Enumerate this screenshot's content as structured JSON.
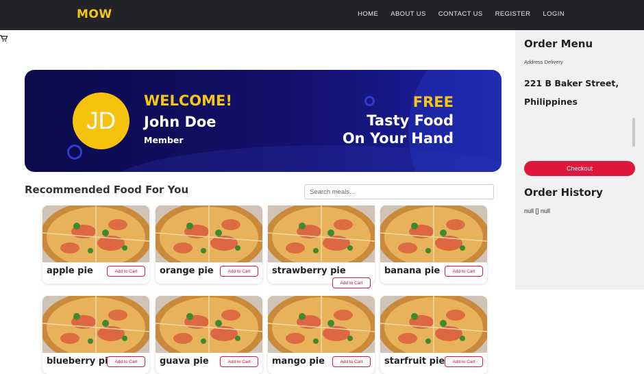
{
  "header": {
    "logo": "MOW",
    "nav": [
      "HOME",
      "ABOUT US",
      "CONTACT US",
      "REGISTER",
      "LOGIN"
    ]
  },
  "banner": {
    "initials": "JD",
    "welcome": "WELCOME!",
    "name": "John Doe",
    "role": "Member",
    "promo_line1": "FREE",
    "promo_line2": "Tasty Food",
    "promo_line3": "On Your Hand"
  },
  "recommended": {
    "title": "Recommended Food For You",
    "search_placeholder": "Search meals...",
    "add_label": "Add to Cart",
    "items": [
      "apple pie",
      "orange pie",
      "strawberry pie",
      "banana pie",
      "blueberry pie",
      "guava pie",
      "mango pie",
      "starfruit pie"
    ]
  },
  "order": {
    "title": "Order Menu",
    "address_label": "Address Delivery",
    "address": "221 B Baker Street, Philippines",
    "checkout": "Checkout",
    "history_title": "Order History",
    "history_value": "null [] null"
  },
  "colors": {
    "accent": "#e0173d",
    "brand_yellow": "#f5c518",
    "banner_bg": "#12106a"
  }
}
